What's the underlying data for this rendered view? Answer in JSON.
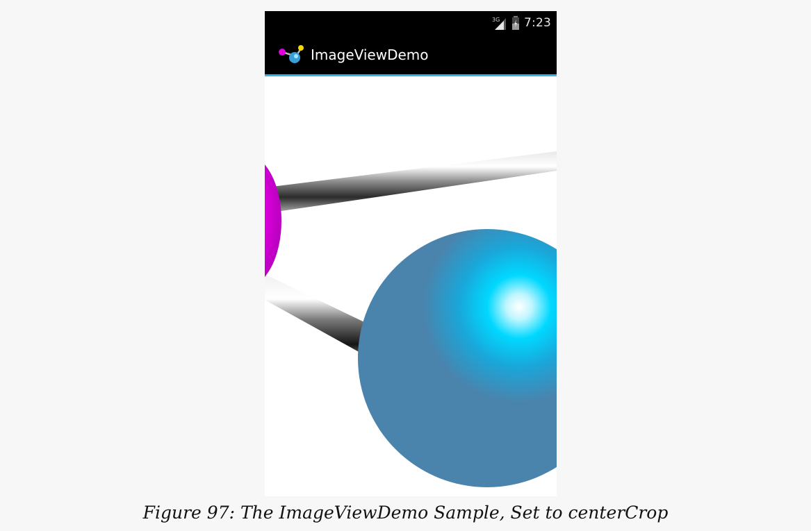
{
  "status_bar": {
    "network_label": "3G",
    "time": "7:23",
    "icons": [
      "signal-3g-icon",
      "battery-icon"
    ]
  },
  "action_bar": {
    "app_icon": "molecule-app-icon",
    "title": "ImageViewDemo",
    "accent_color": "#33b5e5"
  },
  "image_view": {
    "scale_type": "centerCrop",
    "background": "#ffffff",
    "colors": {
      "magenta_atom": "#e000e0",
      "blue_atom": "#4a84ad",
      "highlight": "#00d8ff"
    }
  },
  "caption": {
    "text": "Figure 97: The ImageViewDemo Sample, Set to centerCrop"
  }
}
